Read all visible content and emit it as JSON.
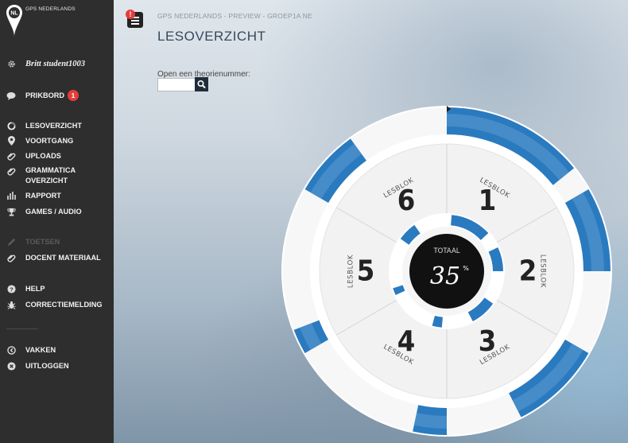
{
  "brand": {
    "name": "GPS NEDERLANDS",
    "logo_text": "NL"
  },
  "sidebar": {
    "user": "Britt student1003",
    "prikbord": {
      "label": "PRIKBORD",
      "badge": "1"
    },
    "items": [
      {
        "label": "LESOVERZICHT",
        "icon": "circle-icon"
      },
      {
        "label": "VOORTGANG",
        "icon": "map-pin-icon"
      },
      {
        "label": "UPLOADS",
        "icon": "paperclip-icon"
      },
      {
        "label": "GRAMMATICA OVERZICHT",
        "icon": "paperclip-icon"
      },
      {
        "label": "RAPPORT",
        "icon": "bar-chart-icon"
      },
      {
        "label": "GAMES / AUDIO",
        "icon": "trophy-icon"
      }
    ],
    "toetsen": "TOETSEN",
    "docent_materiaal": "DOCENT MATERIAAL",
    "help": "HELP",
    "correctiemelding": "CORRECTIEMELDING",
    "vakken": "VAKKEN",
    "uitloggen": "UITLOGGEN"
  },
  "header": {
    "breadcrumb": "GPS NEDERLANDS - PREVIEW - GROEP1A NE",
    "title": "LESOVERZICHT",
    "menu_alert": "!"
  },
  "search": {
    "label": "Open een theorienummer:",
    "value": "",
    "placeholder": ""
  },
  "wheel": {
    "total_label": "TOTAAL",
    "total_value": "35",
    "total_unit": "%",
    "progress": 0.35,
    "segment_label": "LESBLOK",
    "blocks": [
      {
        "number": "1",
        "progress": 0.85
      },
      {
        "number": "2",
        "progress": 0.5
      },
      {
        "number": "3",
        "progress": 0.55
      },
      {
        "number": "4",
        "progress": 0.2
      },
      {
        "number": "5",
        "progress": 0.15
      },
      {
        "number": "6",
        "progress": 0.4
      }
    ],
    "colors": {
      "accent": "#2a7abf",
      "accent_light": "#5b9bd0",
      "ring": "#ffffff",
      "face": "#f2f2f2",
      "hub": "#111111"
    }
  }
}
